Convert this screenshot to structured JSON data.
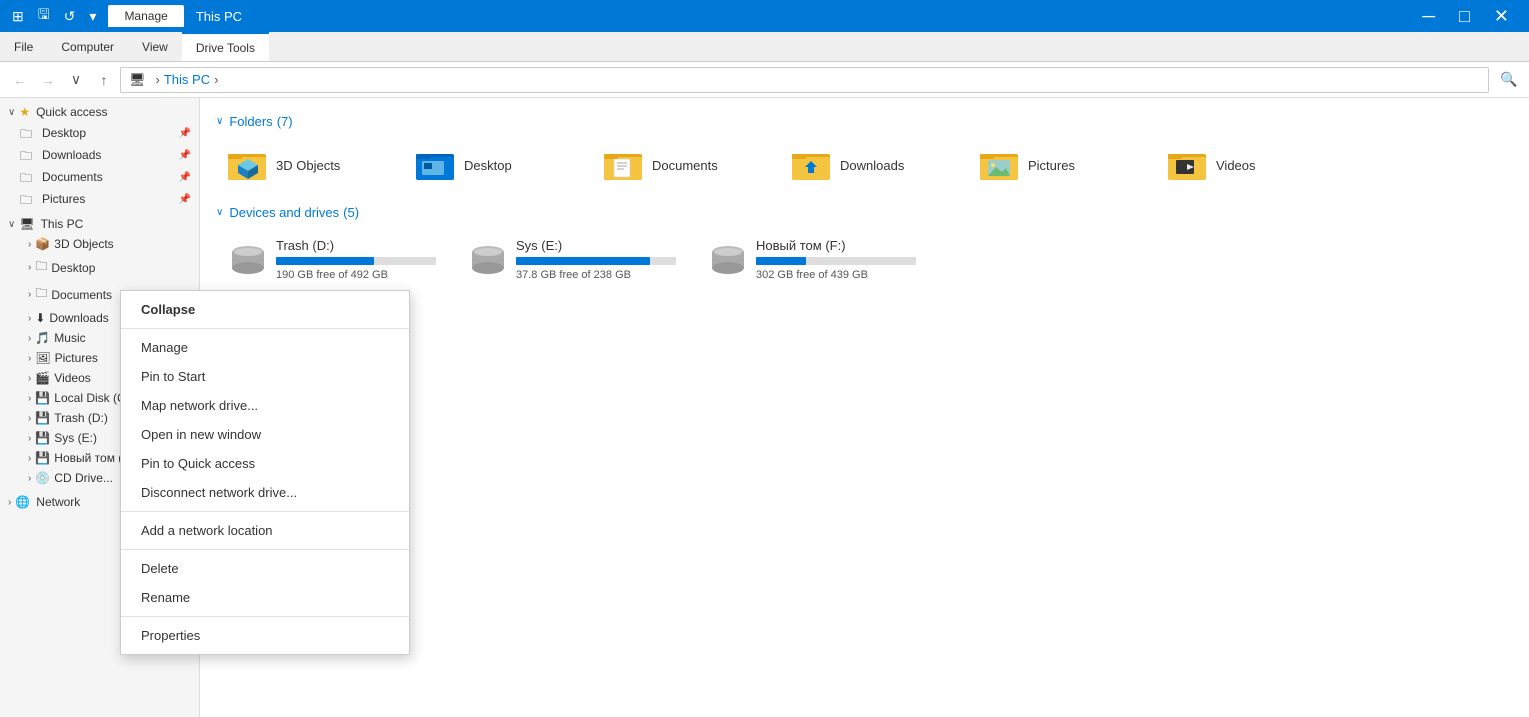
{
  "titleBar": {
    "icons": [
      "⊞",
      "🖫",
      "↩"
    ],
    "activeTab": "Manage",
    "tabs": [
      "Manage"
    ],
    "title": "This PC"
  },
  "ribbon": {
    "tabs": [
      "File",
      "Computer",
      "View",
      "Drive Tools"
    ]
  },
  "addressBar": {
    "path": [
      "This PC"
    ],
    "back": "←",
    "forward": "→",
    "up": "↑",
    "recent": "∨"
  },
  "sidebar": {
    "quickAccess": {
      "label": "Quick access",
      "items": [
        {
          "name": "Desktop",
          "pinned": true
        },
        {
          "name": "Downloads",
          "pinned": true
        },
        {
          "name": "Documents",
          "pinned": true
        },
        {
          "name": "Pictures",
          "pinned": true
        }
      ]
    },
    "thisPC": {
      "label": "This PC",
      "items": [
        {
          "name": "3D Objects"
        },
        {
          "name": "Desktop"
        },
        {
          "name": "Documents"
        },
        {
          "name": "Downloads"
        },
        {
          "name": "Music"
        },
        {
          "name": "Pictures"
        },
        {
          "name": "Videos"
        },
        {
          "name": "Local Disk (C:)"
        },
        {
          "name": "Trash (D:)"
        },
        {
          "name": "Sys (E:)"
        },
        {
          "name": "Новый том (F:)"
        },
        {
          "name": "CD Drive..."
        }
      ]
    },
    "network": {
      "label": "Network"
    }
  },
  "content": {
    "sections": {
      "folders": {
        "label": "Folders",
        "count": "(7)",
        "items": [
          {
            "name": "3D Objects",
            "type": "3d"
          },
          {
            "name": "Desktop",
            "type": "desktop"
          },
          {
            "name": "Documents",
            "type": "docs"
          },
          {
            "name": "Downloads",
            "type": "downloads"
          },
          {
            "name": "Pictures",
            "type": "pictures"
          },
          {
            "name": "Videos",
            "type": "videos"
          }
        ]
      },
      "drives": {
        "label": "Devices and drives",
        "count": "(5)",
        "items": [
          {
            "name": "Trash (D:)",
            "freeGB": 190,
            "totalGB": 492,
            "usedPct": 61
          },
          {
            "name": "Sys (E:)",
            "freeGB": 37.8,
            "totalGB": 238,
            "usedPct": 84
          },
          {
            "name": "Новый том (F:)",
            "freeGB": 302,
            "totalGB": 439,
            "usedPct": 31
          }
        ]
      }
    }
  },
  "contextMenu": {
    "items": [
      {
        "label": "Collapse",
        "bold": true,
        "separator": false
      },
      {
        "label": "",
        "separator": true
      },
      {
        "label": "Manage",
        "bold": false,
        "separator": false
      },
      {
        "label": "Pin to Start",
        "bold": false,
        "separator": false
      },
      {
        "label": "Map network drive...",
        "bold": false,
        "separator": false
      },
      {
        "label": "Open in new window",
        "bold": false,
        "separator": false
      },
      {
        "label": "Pin to Quick access",
        "bold": false,
        "separator": false
      },
      {
        "label": "Disconnect network drive...",
        "bold": false,
        "separator": false
      },
      {
        "label": "",
        "separator": true
      },
      {
        "label": "Add a network location",
        "bold": false,
        "separator": false
      },
      {
        "label": "",
        "separator": true
      },
      {
        "label": "Delete",
        "bold": false,
        "separator": false
      },
      {
        "label": "Rename",
        "bold": false,
        "separator": false
      },
      {
        "label": "",
        "separator": true
      },
      {
        "label": "Properties",
        "bold": false,
        "separator": false
      }
    ]
  }
}
